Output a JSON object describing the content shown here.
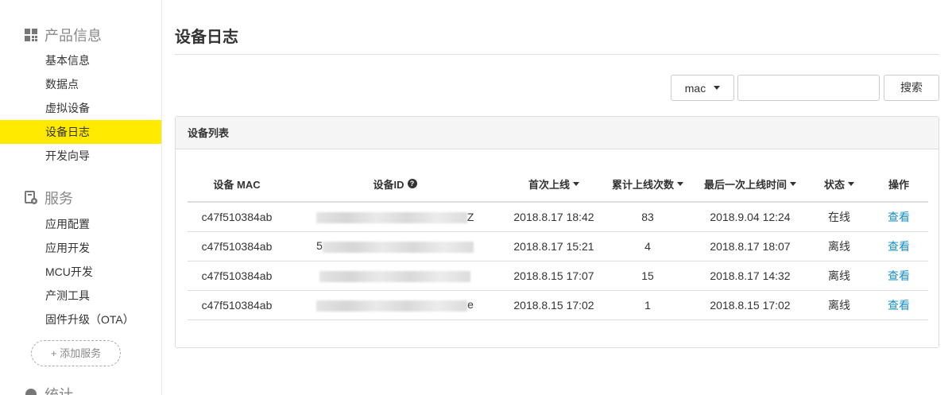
{
  "sidebar": {
    "sections": [
      {
        "title": "产品信息",
        "icon": "grid-icon",
        "items": [
          {
            "label": "基本信息"
          },
          {
            "label": "数据点"
          },
          {
            "label": "虚拟设备"
          },
          {
            "label": "设备日志",
            "active": true
          },
          {
            "label": "开发向导"
          }
        ]
      },
      {
        "title": "服务",
        "icon": "service-icon",
        "items": [
          {
            "label": "应用配置"
          },
          {
            "label": "应用开发"
          },
          {
            "label": "MCU开发"
          },
          {
            "label": "产测工具"
          },
          {
            "label": "固件升级（OTA）"
          }
        ]
      },
      {
        "title": "统计",
        "icon": "stats-icon"
      }
    ],
    "add_service_label": "+ 添加服务"
  },
  "page": {
    "title": "设备日志"
  },
  "search": {
    "field_value": "mac",
    "input_value": "",
    "button_label": "搜索"
  },
  "device_list": {
    "panel_title": "设备列表",
    "columns": [
      "设备 MAC",
      "设备ID",
      "首次上线",
      "累计上线次数",
      "最后一次上线时间",
      "状态",
      "操作"
    ],
    "rows": [
      {
        "mac": "c47f510384ab",
        "id_suffix": "Z",
        "first_online": "2018.8.17 18:42",
        "count": "83",
        "last_online": "2018.9.04 12:24",
        "status": "在线",
        "action": "查看"
      },
      {
        "mac": "c47f510384ab",
        "id_suffix": "5",
        "first_online": "2018.8.17 15:21",
        "count": "4",
        "last_online": "2018.8.17 18:07",
        "status": "离线",
        "action": "查看"
      },
      {
        "mac": "c47f510384ab",
        "id_suffix": "",
        "first_online": "2018.8.15 17:07",
        "count": "15",
        "last_online": "2018.8.17 14:32",
        "status": "离线",
        "action": "查看"
      },
      {
        "mac": "c47f510384ab",
        "id_suffix": "e",
        "first_online": "2018.8.15 17:02",
        "count": "1",
        "last_online": "2018.8.15 17:02",
        "status": "离线",
        "action": "查看"
      }
    ]
  }
}
